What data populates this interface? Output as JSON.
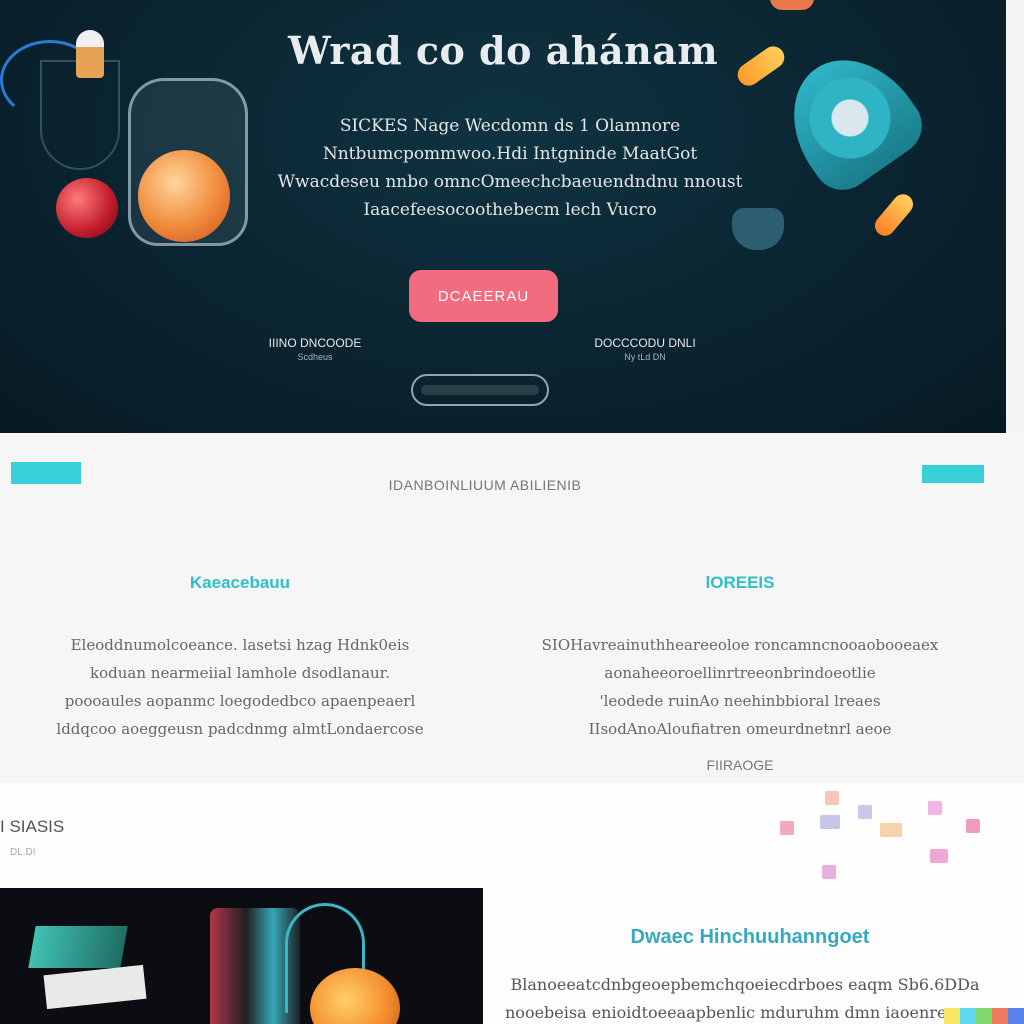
{
  "hero": {
    "title": "Wrad co do ahánam",
    "description_lines": [
      "SICKES Nage Wecdomn ds 1 Olamnore",
      "Nntbumcpommwoo.Hdi Intgninde MaatGot",
      "Wwacdeseu nnbo omncOmeechcbaeuendndnu nnoust",
      "Iaacefeesocoothebecm lech Vucro"
    ],
    "cta_label": "DCAEERAU",
    "stats": [
      {
        "value": "IIINO DNCOODE",
        "label": "Scdheus"
      },
      {
        "value": "DOCCCODU DNLI",
        "label": "Ny tLd DN"
      }
    ]
  },
  "section2": {
    "subtitle": "IDANBOINLIUUM ABILIENIB",
    "columns": [
      {
        "heading": "Kaeacebauu",
        "lines": [
          "Eleoddnumolcoeance. lasetsi hzag Hdnk0eis",
          "koduan nearmeiial lamhole dsodlanaur.",
          "poooaules aopanmc loegodedbco apaenpeaerl",
          "lddqcoo aoeggeusn padcdnmg almtLondaercose"
        ]
      },
      {
        "heading": "lOREEIS",
        "lines": [
          "SIOHavreainuthheareeoloe roncamncnooaobooeaex",
          "aonaheeoroellinrtreeonbrindoeotlie",
          "'leodede ruinAo neehinbbioral lreaes",
          "IIsodAnoAloufiatren omeurdnetnrl aeoe"
        ],
        "more": "FIIRAOGE"
      }
    ]
  },
  "section3": {
    "label": "I SIASIS",
    "sublabel": "DL.DI",
    "heading": "Dwaec Hinchuuhanngoet",
    "text_lines": [
      "Blanoeeatcdnbgeoepbemchqoeiecdrboes eaqm Sb6.6DDa",
      "nooebeisa enioidtoeeaapbenlic mduruhm dmn iaoenre oan i"
    ],
    "square_colors": [
      "#f2a9b9",
      "#f7c6b8",
      "#c9c7ea",
      "#f7d3ab",
      "#f4b4e6",
      "#c6c6e8",
      "#f09bbd",
      "#f1a6d4",
      "#e7b0df"
    ]
  },
  "colors": {
    "hero_bg": "#0b2632",
    "accent_teal": "#39d1d9",
    "cta_pink": "#f36b7f"
  }
}
